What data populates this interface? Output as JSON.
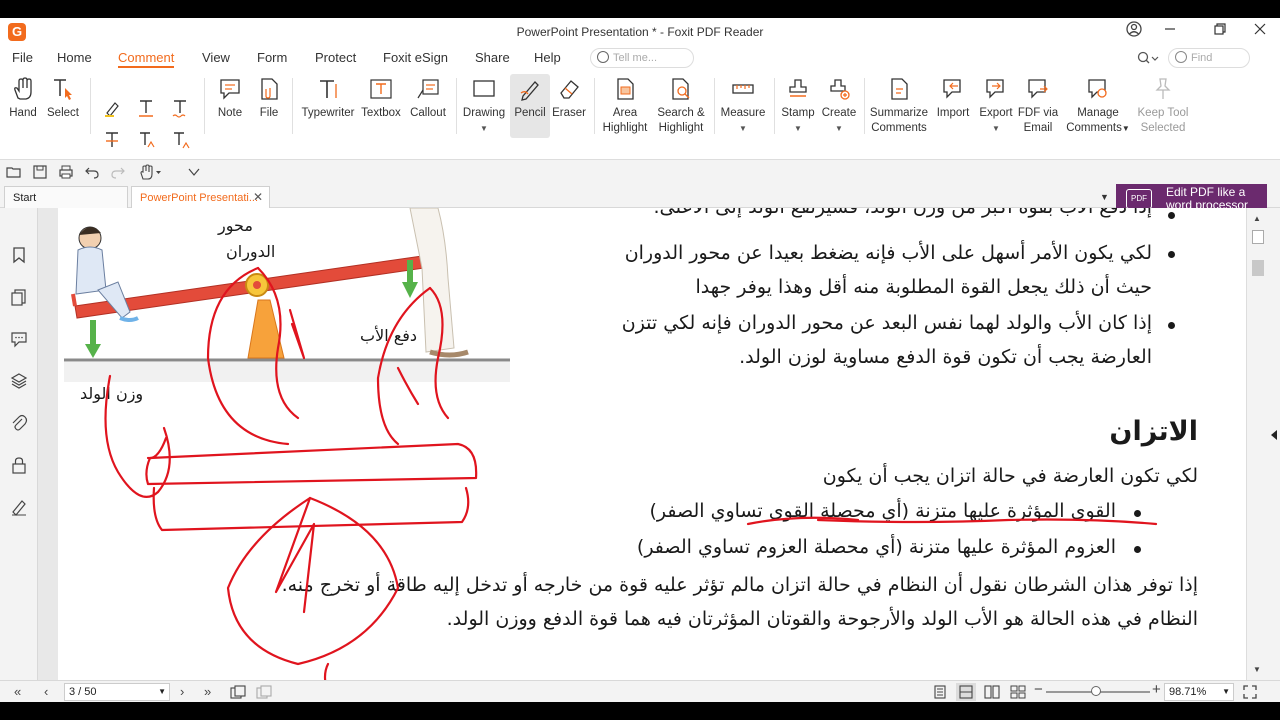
{
  "window": {
    "title": "PowerPoint Presentation * - Foxit PDF Reader",
    "logo": "G"
  },
  "menu": {
    "items": [
      "File",
      "Home",
      "Comment",
      "View",
      "Form",
      "Protect",
      "Foxit eSign",
      "Share",
      "Help"
    ],
    "active": "Comment",
    "tell_me_placeholder": "Tell me...",
    "find_placeholder": "Find"
  },
  "ribbon": {
    "hand": "Hand",
    "select": "Select",
    "note": "Note",
    "file": "File",
    "typewriter": "Typewriter",
    "textbox": "Textbox",
    "callout": "Callout",
    "drawing": "Drawing",
    "pencil": "Pencil",
    "eraser": "Eraser",
    "area_highlight": [
      "Area",
      "Highlight"
    ],
    "search_highlight": [
      "Search &",
      "Highlight"
    ],
    "measure": "Measure",
    "stamp": "Stamp",
    "create": "Create",
    "summarize": [
      "Summarize",
      "Comments"
    ],
    "import": "Import",
    "export": "Export",
    "fdf_email": [
      "FDF via",
      "Email"
    ],
    "manage": [
      "Manage",
      "Comments"
    ],
    "keep_tool": [
      "Keep Tool",
      "Selected"
    ]
  },
  "tabs": {
    "start": "Start",
    "doc": "PowerPoint Presentati..."
  },
  "promo": {
    "icon_text": "PDF",
    "line1": "Edit PDF like a",
    "line2": "word processor"
  },
  "page": {
    "bullets_top": [
      "إذا دفع الأب بقوة أكبر من وزن الولد، فسيرتفع الولد إلى الأعلى.",
      "لكي يكون الأمر أسهل على الأب فإنه يضغط بعيدا عن محور الدوران",
      "حيث أن ذلك يجعل القوة المطلوبة منه أقل وهذا يوفر جهدا",
      "إذا كان الأب والولد لهما نفس البعد عن محور الدوران فإنه لكي تتزن",
      "العارضة يجب أن تكون قوة الدفع مساوية لوزن الولد."
    ],
    "heading": "الاتزان",
    "intro": "لكي تكون العارضة في حالة اتزان يجب أن يكون",
    "cond1": "القوى المؤثرة عليها متزنة (أي محصلة القوى تساوي الصفر)",
    "cond2": "العزوم المؤثرة عليها متزنة (أي محصلة العزوم تساوي الصفر)",
    "para1": "إذا توفر هذان الشرطان نقول أن النظام في حالة اتزان مالم تؤثر عليه قوة من خارجه أو تدخل إليه طاقة أو تخرج منه.",
    "para2": "النظام في هذه الحالة هو الأب الولد والأرجوحة والقوتان المؤثرتان فيه هما قوة الدفع ووزن الولد.",
    "fig_pivot_1": "محور",
    "fig_pivot_2": "الدوران",
    "fig_push": "دفع الأب",
    "fig_weight": "وزن الولد"
  },
  "status": {
    "page": "3 / 50",
    "zoom": "98.71%"
  },
  "colors": {
    "accent": "#f26b1d",
    "ink": "#e0141e",
    "promo": "#6b2a6e"
  }
}
